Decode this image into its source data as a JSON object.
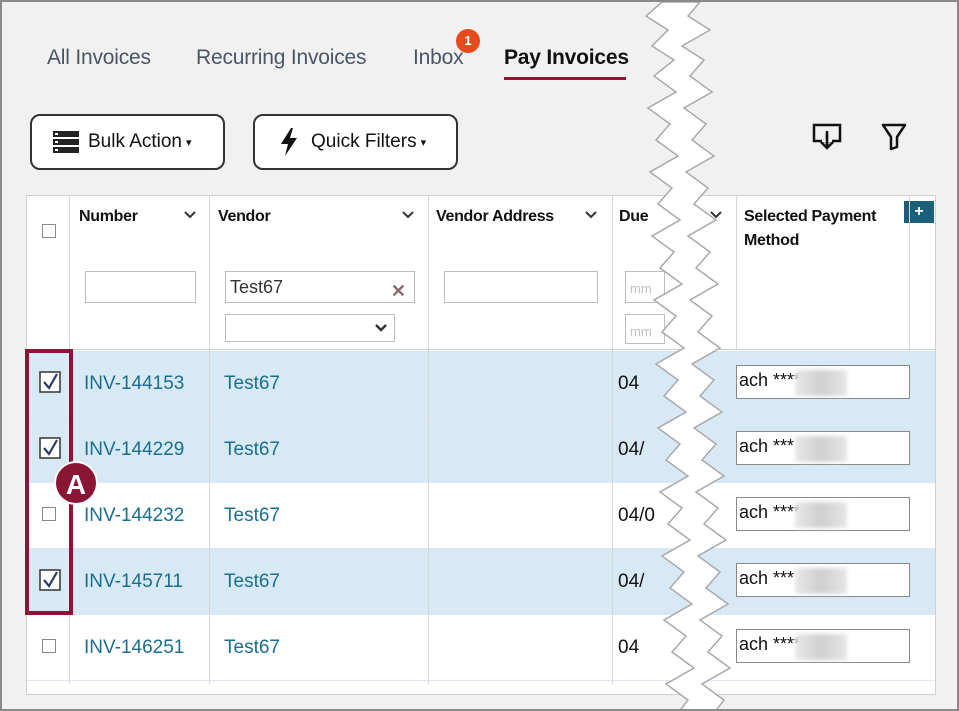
{
  "tabs": [
    {
      "label": "All Invoices"
    },
    {
      "label": "Recurring Invoices"
    },
    {
      "label": "Inbox",
      "badge": "1"
    },
    {
      "label": "Pay Invoices",
      "active": true
    }
  ],
  "toolbar": {
    "bulk_action": "Bulk Action",
    "quick_filters": "Quick Filters",
    "export_icon": "export-icon",
    "filter_icon": "filter-icon"
  },
  "grid": {
    "add_column": "+",
    "columns": [
      {
        "label": "Number"
      },
      {
        "label": "Vendor"
      },
      {
        "label": "Vendor Address"
      },
      {
        "label": "Due"
      },
      {
        "label": "Selected Payment Method"
      }
    ],
    "filters": {
      "number": "",
      "vendor": "Test67",
      "vendor_address": "",
      "due_placeholder": "mm"
    },
    "rows": [
      {
        "selected": true,
        "number": "INV-144153",
        "vendor": "Test67",
        "due": "04",
        "payment": "ach ****"
      },
      {
        "selected": true,
        "number": "INV-144229",
        "vendor": "Test67",
        "due": "04/",
        "payment": "ach ***"
      },
      {
        "selected": false,
        "number": "INV-144232",
        "vendor": "Test67",
        "due": "04/0",
        "payment": "ach ****"
      },
      {
        "selected": true,
        "number": "INV-145711",
        "vendor": "Test67",
        "due": "04/",
        "payment": "ach ***"
      },
      {
        "selected": false,
        "number": "INV-146251",
        "vendor": "Test67",
        "due": "04",
        "payment": "ach ****"
      }
    ]
  },
  "callout": {
    "label": "A",
    "color": "#8b1535"
  },
  "colors": {
    "accent": "#8b1535",
    "link": "#1a6e8e",
    "selected_row": "#d8e9f6",
    "badge": "#e64b1e"
  }
}
